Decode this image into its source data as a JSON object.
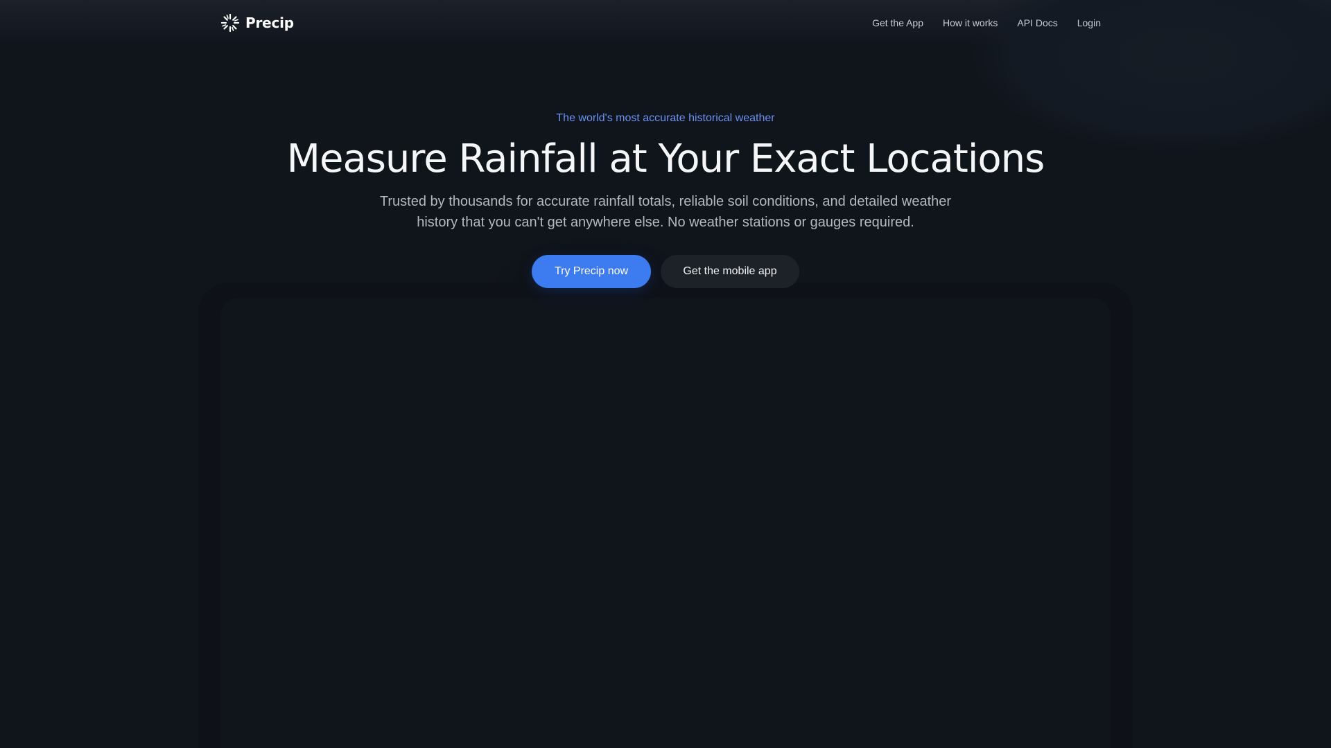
{
  "brand": {
    "name": "Precip",
    "logo_icon": "sunburst-icon"
  },
  "nav": {
    "items": [
      {
        "label": "Get the App"
      },
      {
        "label": "How it works"
      },
      {
        "label": "API Docs"
      },
      {
        "label": "Login"
      }
    ]
  },
  "hero": {
    "eyebrow": "The world's most accurate historical weather",
    "title": "Measure Rainfall at Your Exact Locations",
    "subtitle": "Trusted by thousands for accurate rainfall totals, reliable soil conditions, and detailed weather history that you can't get anywhere else. No weather stations or gauges required.",
    "primary_cta": "Try Precip now",
    "secondary_cta": "Get the mobile app"
  },
  "colors": {
    "background": "#10141b",
    "accent": "#3d7bf0",
    "eyebrow": "#6b93f2",
    "secondary_button": "#1d2128"
  }
}
